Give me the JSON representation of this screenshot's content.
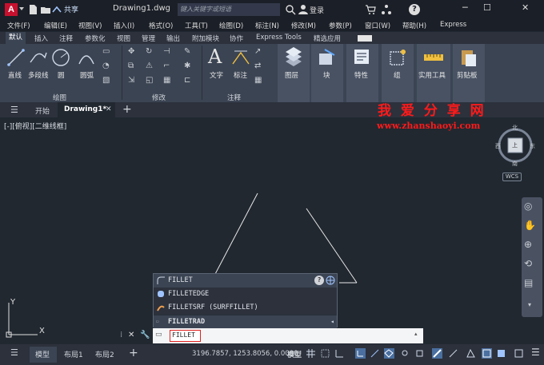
{
  "titlebar": {
    "app_logo": "A",
    "share_label": "共享",
    "document_title": "Drawing1.dwg",
    "search_placeholder": "键入关键字或短语",
    "login_label": "登录",
    "help_label": "?"
  },
  "menubar": {
    "items": [
      "文件(F)",
      "编辑(E)",
      "视图(V)",
      "插入(I)",
      "格式(O)",
      "工具(T)",
      "绘图(D)",
      "标注(N)",
      "修改(M)",
      "参数(P)",
      "窗口(W)",
      "帮助(H)",
      "Express"
    ]
  },
  "ribbon_tabs": {
    "items": [
      "默认",
      "插入",
      "注释",
      "参数化",
      "视图",
      "管理",
      "输出",
      "附加模块",
      "协作",
      "Express Tools",
      "精选应用"
    ],
    "active": "默认"
  },
  "ribbon": {
    "draw_panel": {
      "title": "绘图",
      "line": "直线",
      "polyline": "多段线",
      "circle": "圆",
      "arc": "圆弧"
    },
    "modify_panel": {
      "title": "修改"
    },
    "annotation_panel": {
      "title": "注释",
      "text": "文字",
      "dimension": "标注"
    },
    "layers": "图层",
    "block": "块",
    "properties": "特性",
    "group": "组",
    "utilities": "实用工具",
    "clipboard": "剪贴板"
  },
  "doc_tabs": {
    "start": "开始",
    "drawing": "Drawing1*"
  },
  "viewport": {
    "view_label": "[-][俯视][二维线框]",
    "watermark_cn": "我 爱 分 享 网",
    "watermark_url": "www.zhanshaoyi.com",
    "viewcube": {
      "north": "北",
      "south": "南",
      "east": "东",
      "west": "西",
      "top": "上",
      "wcs": "WCS"
    },
    "ucs_y": "Y",
    "ucs_x": "X"
  },
  "autocomplete": {
    "header": "FILLET",
    "items": [
      "FILLETEDGE",
      "FILLETSRF (SURFFILLET)"
    ],
    "variable": "FILLETRAD"
  },
  "command_line": {
    "value": "FILLET"
  },
  "statusbar": {
    "model_tab": "模型",
    "layout1": "布局1",
    "layout2": "布局2",
    "coordinates": "3196.7857, 1253.8056, 0.0000",
    "model_label": "模型"
  }
}
